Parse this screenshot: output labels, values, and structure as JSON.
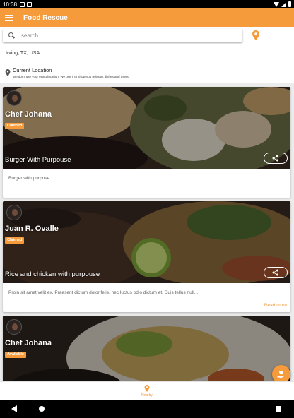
{
  "status_bar": {
    "time": "10:38"
  },
  "app_bar": {
    "title": "Food Rescue"
  },
  "search": {
    "placeholder": "search..."
  },
  "location": {
    "city": "Irving, TX, USA",
    "current_label": "Current Location",
    "current_note": "We don't use your exact location. We use it to show you relevant dishes and users."
  },
  "feed": [
    {
      "chef": "Chef Johana",
      "status": "Claimed",
      "dish": "Burger With Purpouse",
      "description": "Burger with purpose",
      "read_more": ""
    },
    {
      "chef": "Juan R. Ovalle",
      "status": "Claimed",
      "dish": "Rice and chicken with purpouse",
      "description": "Proin sit amet velit ex. Praesent dictum dolor felis, nec luctus odio dictum et. Duis tellus null...",
      "read_more": "Read more"
    },
    {
      "chef": "Chef Johana",
      "status": "Available",
      "dish": "",
      "description": "",
      "read_more": ""
    }
  ],
  "bottom_nav": {
    "nearby_label": "Nearby"
  },
  "colors": {
    "accent": "#f59b3b",
    "app_bar": "#f59b3b",
    "status_badge": "#f59b3b"
  }
}
